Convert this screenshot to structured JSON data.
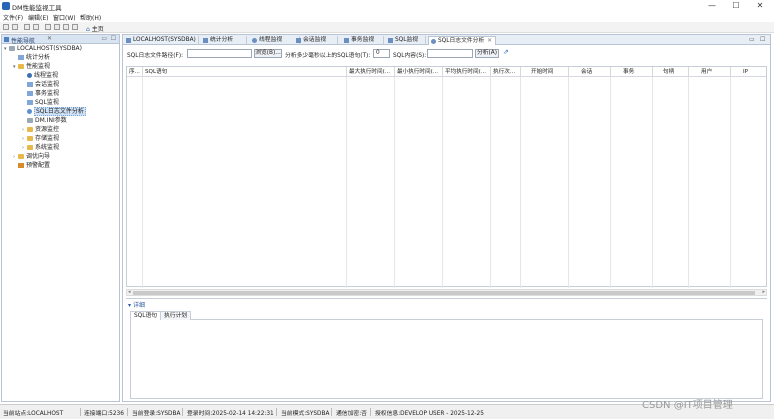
{
  "window": {
    "title": "DM性能监视工具",
    "minimize": "—",
    "maximize": "☐",
    "close": "✕"
  },
  "menu": [
    "文件(F)",
    "编辑(E)",
    "窗口(W)",
    "帮助(H)"
  ],
  "toolbar": {
    "home_label": "主页"
  },
  "nav": {
    "title": "性能导航",
    "items": [
      {
        "label": "LOCALHOST(SYSDBA)",
        "icon": "database-icon"
      },
      {
        "label": "统计分析",
        "icon": "chart-icon"
      },
      {
        "label": "性能监视",
        "icon": "folder-icon"
      },
      {
        "label": "线程监视",
        "icon": "thread-icon"
      },
      {
        "label": "会话监视",
        "icon": "session-icon"
      },
      {
        "label": "事务监视",
        "icon": "transaction-icon"
      },
      {
        "label": "SQL监视",
        "icon": "sql-icon"
      },
      {
        "label": "SQL日志文件分析",
        "icon": "sql-log-icon"
      },
      {
        "label": "DM.INI参数",
        "icon": "ini-icon"
      },
      {
        "label": "资源监控",
        "icon": "folder-icon"
      },
      {
        "label": "存储监视",
        "icon": "folder-icon"
      },
      {
        "label": "系统监视",
        "icon": "folder-icon"
      },
      {
        "label": "调优向导",
        "icon": "folder-icon"
      },
      {
        "label": "预警配置",
        "icon": "warning-icon"
      }
    ]
  },
  "tabs": [
    {
      "label": "LOCALHOST(SYSDBA)"
    },
    {
      "label": "统计分析"
    },
    {
      "label": "线程监视"
    },
    {
      "label": "会话监视"
    },
    {
      "label": "事务监视"
    },
    {
      "label": "SQL监视"
    },
    {
      "label": "SQL日志文件分析"
    }
  ],
  "filters": {
    "path_label": "SQL日志文件路径(F):",
    "path_value": "",
    "browse_label": "浏览(B)...",
    "seconds_label": "分析多少毫秒以上的SQL语句(T):",
    "seconds_value": "0",
    "content_label": "SQL内容(S):",
    "content_value": "",
    "analyze_label": "分析(A)"
  },
  "grid": {
    "columns": [
      "序...",
      "SQL语句",
      "最大执行时间(...",
      "最小执行时间(...",
      "平均执行时间(...",
      "执行次...",
      "开始时间",
      "会话",
      "事务",
      "句柄",
      "用户",
      "IP"
    ]
  },
  "details": {
    "title": "详细",
    "tabs": [
      "SQL语句",
      "执行计划"
    ]
  },
  "status": {
    "site": "当前站点:LOCALHOST",
    "port": "连接端口:5236",
    "login": "当前登录:SYSDBA",
    "login_time": "登录时间:2025-02-14 14:22:31",
    "mode": "当前模式:SYSDBA",
    "encryption": "通信加密:否",
    "license": "授权信息:DEVELOP USER - 2025-12-25"
  },
  "watermark": "CSDN @IT项目管理"
}
